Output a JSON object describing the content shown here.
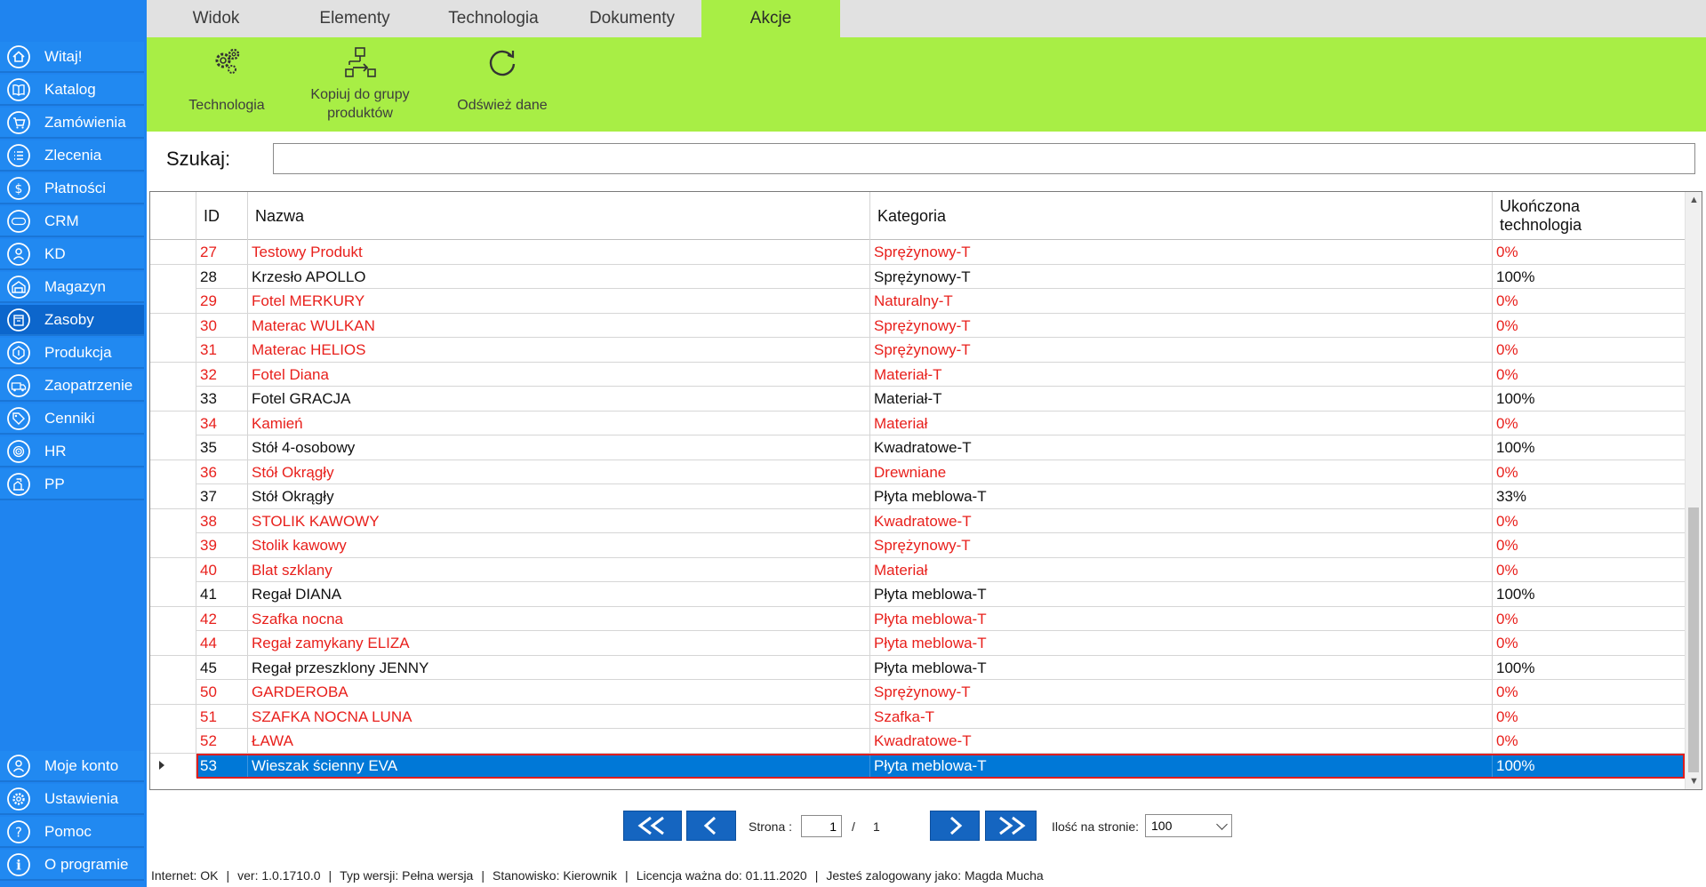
{
  "sidebar": {
    "top_items": [
      {
        "label": "Witaj!",
        "icon": "home-icon"
      },
      {
        "label": "Katalog",
        "icon": "book-icon"
      },
      {
        "label": "Zamówienia",
        "icon": "cart-icon"
      },
      {
        "label": "Zlecenia",
        "icon": "list-icon"
      },
      {
        "label": "Płatności",
        "icon": "dollar-icon"
      },
      {
        "label": "CRM",
        "icon": "crm-icon"
      },
      {
        "label": "KD",
        "icon": "person-icon"
      },
      {
        "label": "Magazyn",
        "icon": "warehouse-icon"
      },
      {
        "label": "Zasoby",
        "icon": "box-icon"
      },
      {
        "label": "Produkcja",
        "icon": "factory-icon"
      },
      {
        "label": "Zaopatrzenie",
        "icon": "truck-icon"
      },
      {
        "label": "Cenniki",
        "icon": "tag-icon"
      },
      {
        "label": "HR",
        "icon": "fingerprint-icon"
      },
      {
        "label": "PP",
        "icon": "document-icon"
      }
    ],
    "active_index": 8,
    "bottom_items": [
      {
        "label": "Moje konto",
        "icon": "account-icon"
      },
      {
        "label": "Ustawienia",
        "icon": "gear-icon"
      },
      {
        "label": "Pomoc",
        "icon": "help-icon"
      },
      {
        "label": "O programie",
        "icon": "info-icon"
      }
    ]
  },
  "tabs": [
    {
      "label": "Widok"
    },
    {
      "label": "Elementy"
    },
    {
      "label": "Technologia"
    },
    {
      "label": "Dokumenty"
    },
    {
      "label": "Akcje"
    }
  ],
  "active_tab": "Akcje",
  "ribbon": {
    "technologia": {
      "label": "Technologia",
      "icon": "gears-icon"
    },
    "kopiuj": {
      "label_line1": "Kopiuj do grupy",
      "label_line2": "produktów",
      "icon": "copy-to-group-icon"
    },
    "odswiez": {
      "label": "Odśwież dane",
      "icon": "refresh-icon"
    }
  },
  "search": {
    "label": "Szukaj:",
    "value": "",
    "placeholder": ""
  },
  "grid": {
    "columns": {
      "id": "ID",
      "nazwa": "Nazwa",
      "kategoria": "Kategoria",
      "ukonczona_line1": "Ukończona",
      "ukonczona_line2": "technologia"
    },
    "rows": [
      {
        "id": "27",
        "nazwa": "Testowy Produkt",
        "kategoria": "Sprężynowy-T",
        "tech": "0%",
        "red": true
      },
      {
        "id": "28",
        "nazwa": "Krzesło APOLLO",
        "kategoria": "Sprężynowy-T",
        "tech": "100%",
        "red": false
      },
      {
        "id": "29",
        "nazwa": "Fotel MERKURY",
        "kategoria": "Naturalny-T",
        "tech": "0%",
        "red": true
      },
      {
        "id": "30",
        "nazwa": "Materac WULKAN",
        "kategoria": "Sprężynowy-T",
        "tech": "0%",
        "red": true
      },
      {
        "id": "31",
        "nazwa": "Materac HELIOS",
        "kategoria": "Sprężynowy-T",
        "tech": "0%",
        "red": true
      },
      {
        "id": "32",
        "nazwa": "Fotel Diana",
        "kategoria": "Materiał-T",
        "tech": "0%",
        "red": true
      },
      {
        "id": "33",
        "nazwa": "Fotel GRACJA",
        "kategoria": "Materiał-T",
        "tech": "100%",
        "red": false
      },
      {
        "id": "34",
        "nazwa": "Kamień",
        "kategoria": "Materiał",
        "tech": "0%",
        "red": true
      },
      {
        "id": "35",
        "nazwa": "Stół 4-osobowy",
        "kategoria": "Kwadratowe-T",
        "tech": "100%",
        "red": false
      },
      {
        "id": "36",
        "nazwa": "Stół Okrągły",
        "kategoria": "Drewniane",
        "tech": "0%",
        "red": true
      },
      {
        "id": "37",
        "nazwa": "Stół Okrągły",
        "kategoria": "Płyta meblowa-T",
        "tech": "33%",
        "red": false
      },
      {
        "id": "38",
        "nazwa": "STOLIK KAWOWY",
        "kategoria": "Kwadratowe-T",
        "tech": "0%",
        "red": true
      },
      {
        "id": "39",
        "nazwa": "Stolik kawowy",
        "kategoria": "Sprężynowy-T",
        "tech": "0%",
        "red": true
      },
      {
        "id": "40",
        "nazwa": "Blat szklany",
        "kategoria": "Materiał",
        "tech": "0%",
        "red": true
      },
      {
        "id": "41",
        "nazwa": "Regał DIANA",
        "kategoria": "Płyta meblowa-T",
        "tech": "100%",
        "red": false
      },
      {
        "id": "42",
        "nazwa": "Szafka nocna",
        "kategoria": "Płyta meblowa-T",
        "tech": "0%",
        "red": true
      },
      {
        "id": "44",
        "nazwa": "Regał zamykany ELIZA",
        "kategoria": "Płyta meblowa-T",
        "tech": "0%",
        "red": true
      },
      {
        "id": "45",
        "nazwa": "Regał przeszklony JENNY",
        "kategoria": "Płyta meblowa-T",
        "tech": "100%",
        "red": false
      },
      {
        "id": "50",
        "nazwa": "GARDEROBA",
        "kategoria": "Sprężynowy-T",
        "tech": "0%",
        "red": true
      },
      {
        "id": "51",
        "nazwa": "SZAFKA NOCNA LUNA",
        "kategoria": "Szafka-T",
        "tech": "0%",
        "red": true
      },
      {
        "id": "52",
        "nazwa": "ŁAWA",
        "kategoria": "Kwadratowe-T",
        "tech": "0%",
        "red": true
      },
      {
        "id": "53",
        "nazwa": "Wieszak ścienny EVA",
        "kategoria": "Płyta meblowa-T",
        "tech": "100%",
        "red": false,
        "selected": true
      }
    ]
  },
  "pagination": {
    "strona_label": "Strona :",
    "current_page": "1",
    "separator": "/",
    "total_pages": "1",
    "per_page_label": "Ilość na stronie:",
    "per_page_value": "100"
  },
  "status": {
    "internet": "Internet: OK",
    "version": "ver: 1.0.1710.0",
    "typ": "Typ wersji: Pełna wersja",
    "stanowisko": "Stanowisko: Kierownik",
    "licencja": "Licencja ważna do: 01.11.2020",
    "user": "Jesteś zalogowany jako: Magda Mucha",
    "sep": "|"
  },
  "colors": {
    "sidebar": "#1f84ef",
    "ribbon": "#a8ee45",
    "red_text": "#e8201c",
    "selection": "#0078d7",
    "pager_button": "#1565c0"
  }
}
